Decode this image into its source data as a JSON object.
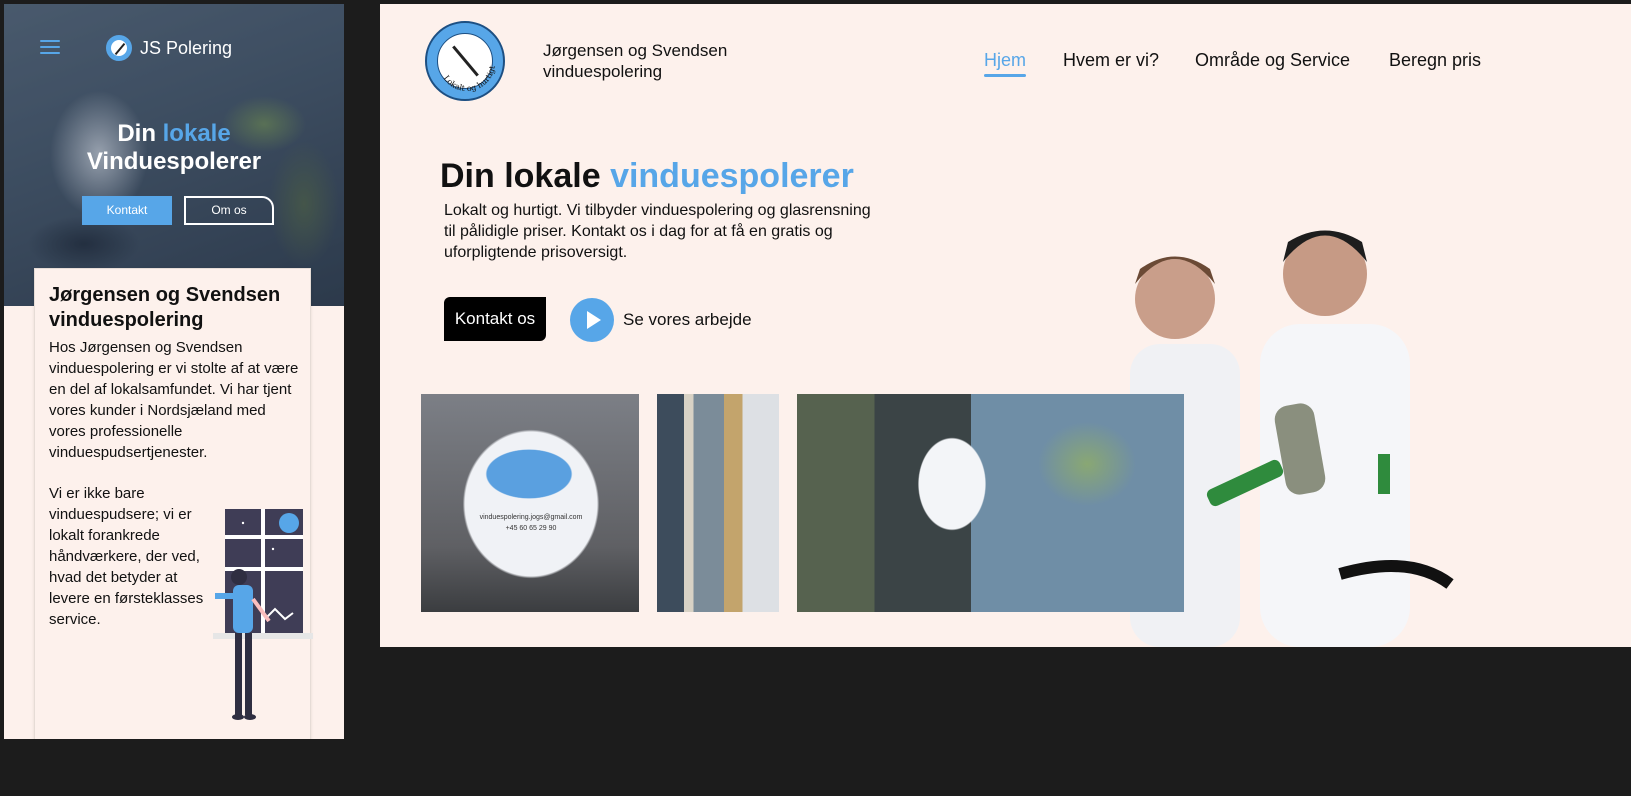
{
  "mobile": {
    "brand": "JS Polering",
    "hero": {
      "title_pre": "Din ",
      "title_accent": "lokale",
      "title_post": "Vinduespolerer",
      "button_kontakt": "Kontakt",
      "button_om": "Om os"
    },
    "card": {
      "title": "Jørgensen og Svendsen vinduespolering",
      "text1": "Hos Jørgensen og Svendsen vinduespolering er vi stolte af at være en del af lokalsamfundet. Vi har tjent vores kunder i Nordsjæland med vores professionelle vinduespudsertjenester.",
      "text2": "Vi er ikke bare vinduespudsere; vi er lokalt forankrede håndværkere, der ved, hvad det betyder at levere en førsteklasses service."
    }
  },
  "desktop": {
    "brand_line1": "Jørgensen og Svendsen",
    "brand_line2": "vinduespolering",
    "logo_text": "Lokalt og hurtigt",
    "nav": [
      {
        "label": "Hjem",
        "active": true
      },
      {
        "label": "Hvem er vi?",
        "active": false
      },
      {
        "label": "Område og Service",
        "active": false
      },
      {
        "label": "Beregn pris",
        "active": false
      }
    ],
    "hero": {
      "title_pre": "Din lokale ",
      "title_accent": "vinduespolerer",
      "subtitle": "Lokalt og hurtigt. Vi tilbyder vinduespolering og glasrensning til pålidigle priser. Kontakt os i dag for at få en gratis og uforpligtende prisoversigt.",
      "button_kontakt": "Kontakt os",
      "watch_label": "Se vores arbejde"
    },
    "shirt_email": "vinduespolering.jogs@gmail.com",
    "shirt_phone": "+45 60 65 29 90"
  },
  "colors": {
    "accent": "#57a6e8",
    "page_bg": "#fdf1ec",
    "frame_bg": "#1c1c1c"
  }
}
